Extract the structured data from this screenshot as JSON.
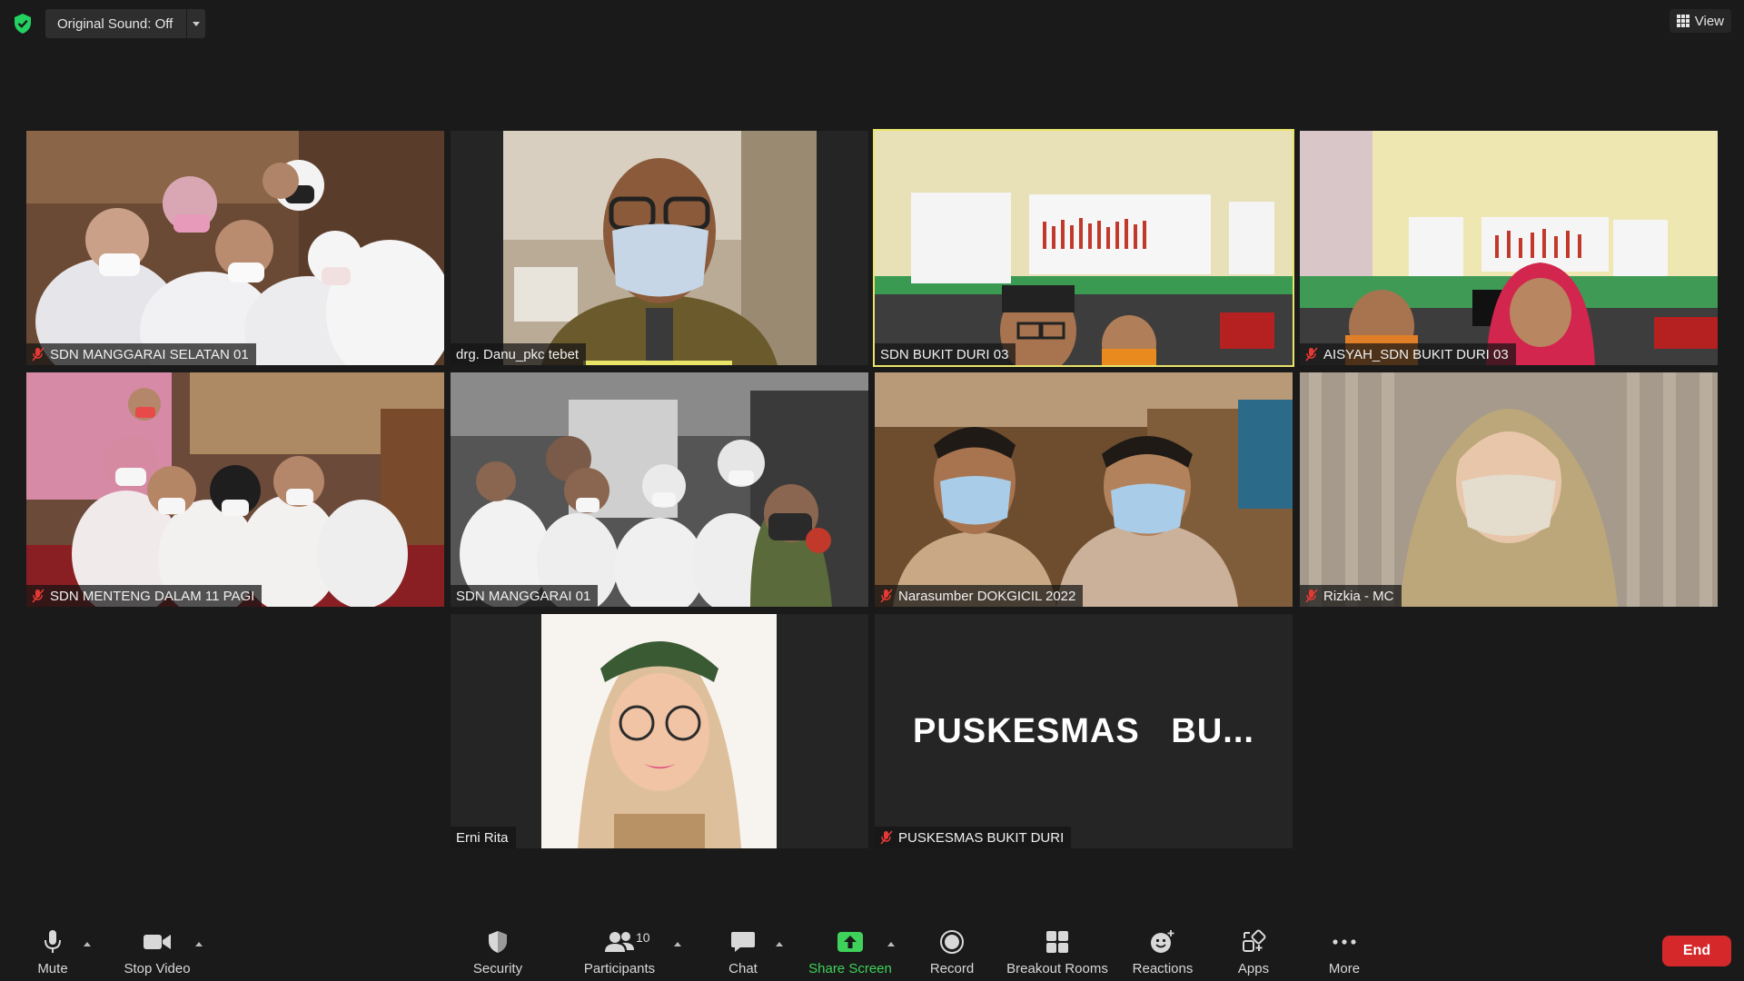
{
  "colors": {
    "background": "#1a1a1a",
    "active_speaker": "#e8e46a",
    "share": "#3ed25a",
    "end": "#d5282b",
    "security": "#23d160"
  },
  "topbar": {
    "security_icon": "shield-check-icon",
    "original_sound_label": "Original Sound: Off",
    "view_label": "View"
  },
  "tiles": [
    {
      "name": "SDN MANGGARAI SELATAN 01",
      "muted": true
    },
    {
      "name": "drg. Danu_pkc tebet",
      "muted": false
    },
    {
      "name": "SDN BUKIT DURI 03",
      "muted": false,
      "active": true
    },
    {
      "name": "AISYAH_SDN BUKIT DURI 03",
      "muted": true
    },
    {
      "name": "SDN MENTENG DALAM 11 PAGI",
      "muted": true
    },
    {
      "name": "SDN MANGGARAI 01",
      "muted": false
    },
    {
      "name": "Narasumber DOKGICIL 2022",
      "muted": true
    },
    {
      "name": "Rizkia - MC",
      "muted": true
    },
    {
      "name": "Erni Rita",
      "muted": false
    },
    {
      "name": "PUSKESMAS BUKIT DURI",
      "muted": true,
      "display_text": "PUSKESMAS   BU..."
    }
  ],
  "toolbar": {
    "mute": "Mute",
    "stop_video": "Stop Video",
    "security": "Security",
    "participants": "Participants",
    "participants_count": "10",
    "chat": "Chat",
    "share_screen": "Share Screen",
    "record": "Record",
    "breakout_rooms": "Breakout Rooms",
    "reactions": "Reactions",
    "apps": "Apps",
    "more": "More",
    "end": "End"
  }
}
